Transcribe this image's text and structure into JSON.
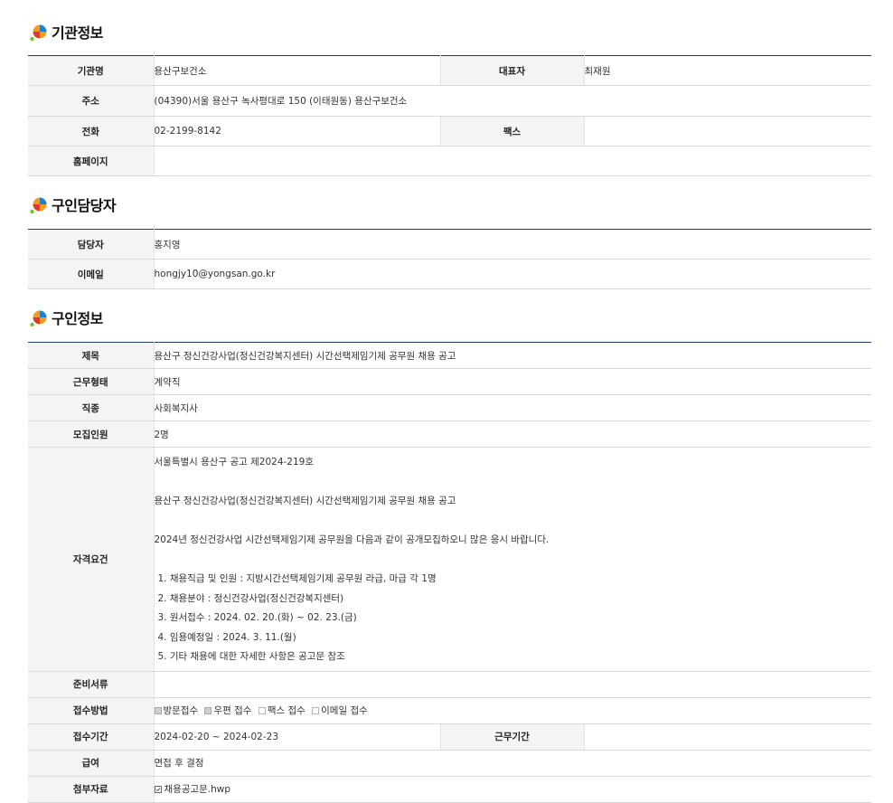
{
  "colors": {
    "header_rule": "#1f3d62",
    "icon_blue": "#1e7fd4",
    "icon_orange": "#f59a1c",
    "icon_red": "#e0392e",
    "icon_green": "#7cbf2d",
    "label_bg": "#f4f4f4"
  },
  "agency": {
    "title": "기관정보",
    "name_label": "기관명",
    "name_value": "용산구보건소",
    "rep_label": "대표자",
    "rep_value": "최재원",
    "address_label": "주소",
    "address_value": "(04390)서울 용산구 녹사평대로 150 (이태원동) 용산구보건소",
    "phone_label": "전화",
    "phone_value": "02-2199-8142",
    "fax_label": "팩스",
    "fax_value": "",
    "homepage_label": "홈페이지",
    "homepage_value": ""
  },
  "contact": {
    "title": "구인담당자",
    "person_label": "담당자",
    "person_value": "홍지영",
    "email_label": "이메일",
    "email_value": "hongjy10@yongsan.go.kr"
  },
  "job": {
    "title": "구인정보",
    "subject_label": "제목",
    "subject_value": "용산구 정신건강사업(정신건강복지센터) 시간선택제임기제 공무원 채용 공고",
    "worktype_label": "근무형태",
    "worktype_value": "계약직",
    "category_label": "직종",
    "category_value": "사회복지사",
    "headcount_label": "모집인원",
    "headcount_value": "2명",
    "qual_label": "자격요건",
    "qual_line1": "서울특별시 용산구 공고 제2024-219호",
    "qual_line2": "용산구 정신건강사업(정신건강복지센터) 시간선택제임기제 공무원 채용 공고",
    "qual_line3": "2024년 정신건강사업 시간선택제임기제 공무원을 다음과 같이 공개모집하오니 많은 응시 바랍니다.",
    "qual_items": [
      "1. 채용직급 및 인원 : 지방시간선택제임기제 공무원 라급, 마급 각 1명",
      "2. 채용분야 : 정신건강사업(정신건강복지센터)",
      "3. 원서접수 : 2024. 02. 20.(화) ~ 02. 23.(금)",
      "4. 임용예정일 : 2024. 3. 11.(월)",
      "5. 기타 채용에 대한 자세한 사항은 공고문 참조"
    ],
    "docs_label": "준비서류",
    "docs_value": "",
    "method_label": "접수방법",
    "methods": [
      {
        "label": "방문접수",
        "checked": true
      },
      {
        "label": "우편 접수",
        "checked": true
      },
      {
        "label": "팩스 접수",
        "checked": false
      },
      {
        "label": "이메일 접수",
        "checked": false
      }
    ],
    "period_label": "접수기간",
    "period_value": "2024-02-20 ~ 2024-02-23",
    "workperiod_label": "근무기간",
    "workperiod_value": "",
    "salary_label": "급여",
    "salary_value": "면접 후 결정",
    "attach_label": "첨부자료",
    "attach_value": "채용공고문.hwp"
  }
}
